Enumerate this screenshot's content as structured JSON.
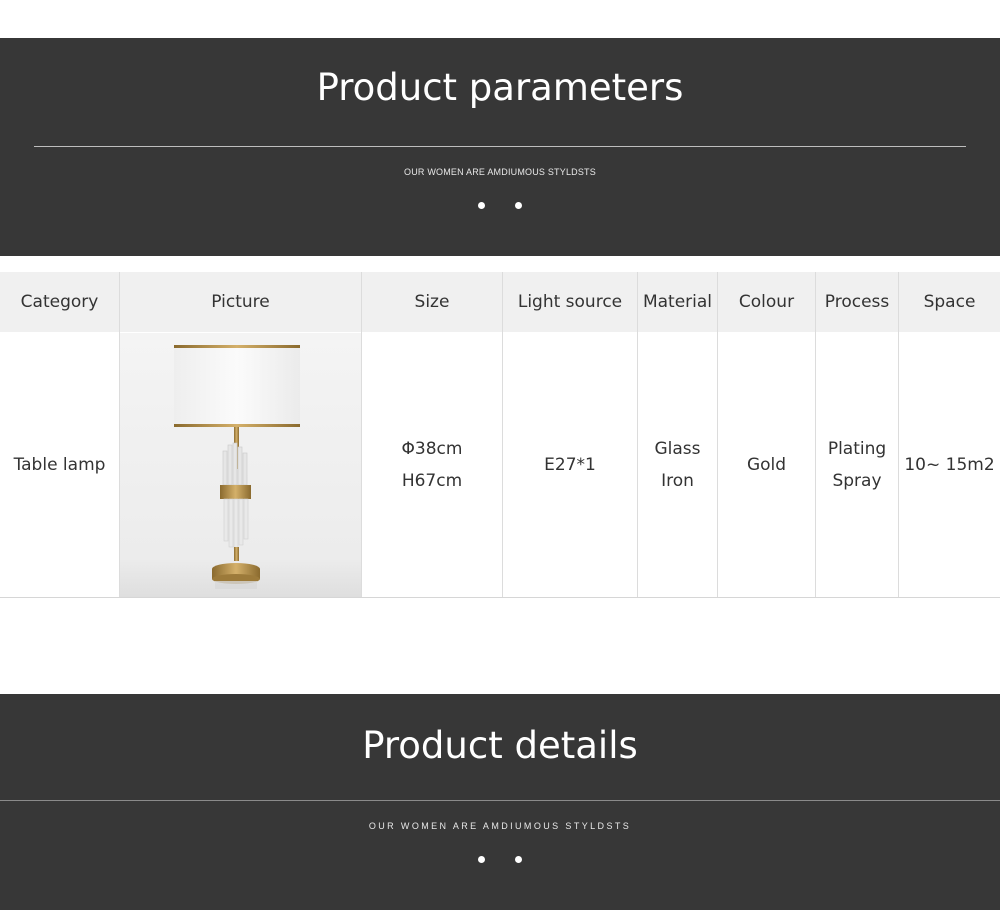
{
  "parameters_banner": {
    "title": "Product parameters",
    "subtitle": "OUR WOMEN ARE AMDIUMOUS STYLDSTS"
  },
  "table": {
    "headers": [
      "Category",
      "Picture",
      "Size",
      "Light source",
      "Material",
      "Colour",
      "Process",
      "Space"
    ],
    "row": {
      "category": "Table lamp",
      "size_line1": "Φ38cm",
      "size_line2": "H67cm",
      "light_source": "E27*1",
      "material_line1": "Glass",
      "material_line2": "Iron",
      "colour": "Gold",
      "process_line1": "Plating",
      "process_line2": "Spray",
      "space": "10~ 15m2"
    },
    "picture_icon": "table-lamp-image"
  },
  "details_banner": {
    "title": "Product details",
    "subtitle": "OUR WOMEN ARE AMDIUMOUS STYLDSTS"
  },
  "colors": {
    "banner_bg": "#373737",
    "header_bg": "#f0f0f0",
    "lamp_gold": "#b8924a",
    "lamp_shade": "#f7f7f7"
  }
}
